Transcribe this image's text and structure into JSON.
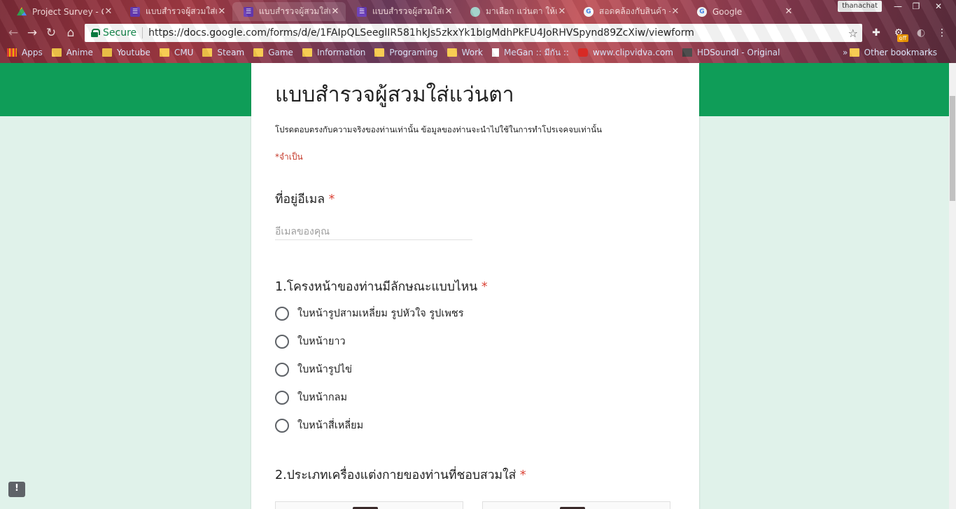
{
  "browser": {
    "tabs": [
      {
        "title": "Project Survey - Go",
        "icon": "drive-icon"
      },
      {
        "title": "แบบสำรวจผู้สวมใส่แว่นต",
        "icon": "forms-icon"
      },
      {
        "title": "แบบสำรวจผู้สวมใส่แว่นต",
        "icon": "forms-icon"
      },
      {
        "title": "แบบสำรวจผู้สวมใส่แว่น",
        "icon": "forms-icon"
      },
      {
        "title": "มาเลือก แว่นตา ให้เหม",
        "icon": "site-icon"
      },
      {
        "title": "สอดคล้องกับสินค้า - ค้น",
        "icon": "google-icon"
      },
      {
        "title": "Google",
        "icon": "google-icon"
      }
    ],
    "profile_name": "thanachat",
    "secure_label": "Secure",
    "url": "https://docs.google.com/forms/d/e/1FAIpQLSeeglIR581hkJs5zkxYk1bIgMdhPkFU4JoRHVSpynd89ZcXiw/viewform",
    "ext_badge": "off",
    "bookmarks": [
      {
        "label": "Apps",
        "icon": "apps-icon"
      },
      {
        "label": "Anime",
        "icon": "folder-icon"
      },
      {
        "label": "Youtube",
        "icon": "folder-icon"
      },
      {
        "label": "CMU",
        "icon": "folder-icon"
      },
      {
        "label": "Steam",
        "icon": "folder-icon"
      },
      {
        "label": "Game",
        "icon": "folder-icon"
      },
      {
        "label": "Information",
        "icon": "folder-icon"
      },
      {
        "label": "Programing",
        "icon": "folder-icon"
      },
      {
        "label": "Work",
        "icon": "folder-icon"
      },
      {
        "label": "MeGan :: มีกัน ::",
        "icon": "page-icon"
      },
      {
        "label": "www.clipvidva.com",
        "icon": "video-icon"
      },
      {
        "label": "HDSoundI - Original",
        "icon": "hd-icon"
      }
    ],
    "other_bookmarks": "Other bookmarks",
    "overflow_chevron": "»"
  },
  "form": {
    "title": "แบบสำรวจผู้สวมใส่แว่นตา",
    "description": "โปรดตอบตรงกับความจริงของท่านเท่านั้น ข้อมูลของท่านจะนำไปใช้ในการทำโปรเจคจบเท่านั้น",
    "required_note": "*จำเป็น",
    "email": {
      "label": "ที่อยู่อีเมล",
      "required_mark": "*",
      "placeholder": "อีเมลของคุณ"
    },
    "question1": {
      "label": "1.โครงหน้าของท่านมีลักษณะแบบไหน",
      "required_mark": "*",
      "options": [
        "ใบหน้ารูปสามเหลี่ยม รูปหัวใจ รูปเพชร",
        "ใบหน้ายาว",
        "ใบหน้ารูปไข่",
        "ใบหน้ากลม",
        "ใบหน้าสี่เหลี่ยม"
      ]
    },
    "question2": {
      "label": "2.ประเภทเครื่องแต่งกายของท่านที่ชอบสวมใส่",
      "required_mark": "*"
    }
  },
  "colors": {
    "header_band": "#0f9d58",
    "page_background": "#e0f2ea",
    "required_red": "#db4437"
  }
}
